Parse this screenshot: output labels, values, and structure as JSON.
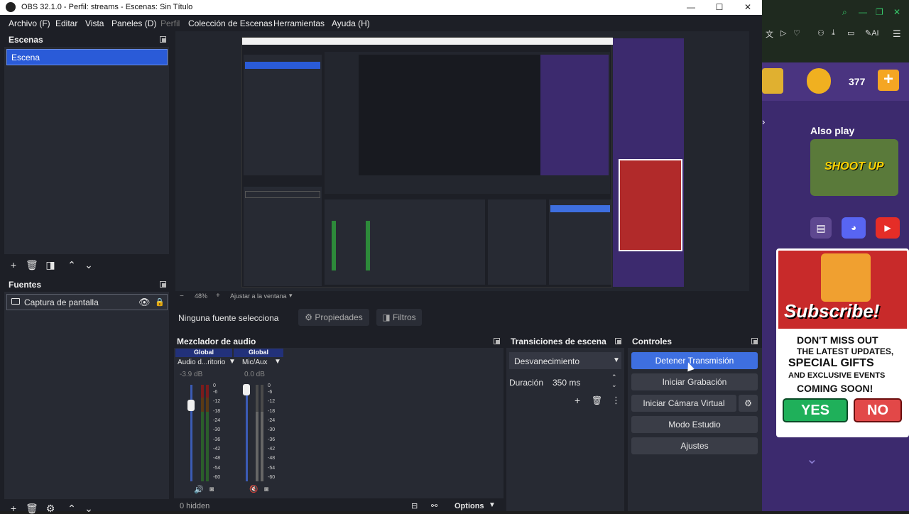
{
  "window": {
    "title": "OBS 32.1.0 - Perfil: streams - Escenas: Sin Título",
    "minimize": "—",
    "maximize": "☐",
    "close": "✕"
  },
  "menu": [
    "Archivo (F)",
    "Editar",
    "Vista",
    "Paneles (D)",
    "Perfil",
    "Colección de Escenas",
    "Herramientas",
    "Ayuda (H)"
  ],
  "scenes": {
    "title": "Escenas",
    "items": [
      "Escena"
    ]
  },
  "sources": {
    "title": "Fuentes",
    "items": [
      "Captura de pantalla"
    ]
  },
  "props_bar": {
    "no_source": "Ninguna fuente selecciona",
    "properties": "Propiedades",
    "filters": "Filtros"
  },
  "audio": {
    "title": "Mezclador de audio",
    "channels": [
      {
        "group": "Global",
        "name": "Audio d...ritorio",
        "db": "-3.9 dB",
        "level": 0.72
      },
      {
        "group": "Global",
        "name": "Mic/Aux",
        "db": "0.0 dB",
        "level": 0.98
      }
    ],
    "ticks": [
      "0",
      "-6",
      "-12",
      "-18",
      "-24",
      "-30",
      "-36",
      "-42",
      "-48",
      "-54",
      "-60"
    ],
    "hidden": "0 hidden",
    "options": "Options"
  },
  "transitions": {
    "title": "Transiciones de escena",
    "selected": "Desvanecimiento",
    "duration_label": "Duración",
    "duration_value": "350 ms"
  },
  "controls": {
    "title": "Controles",
    "stop_stream": "Detener Transmisión",
    "start_record": "Iniciar Grabación",
    "start_virtual": "Iniciar Cámara Virtual",
    "studio": "Modo Estudio",
    "settings": "Ajustes"
  },
  "preview": {
    "zoom": "48%",
    "fit": "Ajustar a la ventana"
  },
  "game": {
    "coins": "377",
    "plus": "+",
    "also_play": "Also play",
    "game_title": "SHOOT UP",
    "subscribe": "Subscribe!",
    "dont_miss": "DON'T MISS OUT",
    "latest": "THE LATEST UPDATES,",
    "special": "SPECIAL GIFTS",
    "exclusive": "AND EXCLUSIVE EVENTS",
    "coming": "COMING SOON!",
    "yes": "YES",
    "no": "NO"
  },
  "colors": {
    "accent": "#3e6fe0",
    "background": "#1d1f26",
    "panel": "#272a33",
    "game_bg": "#3c2a6e"
  }
}
